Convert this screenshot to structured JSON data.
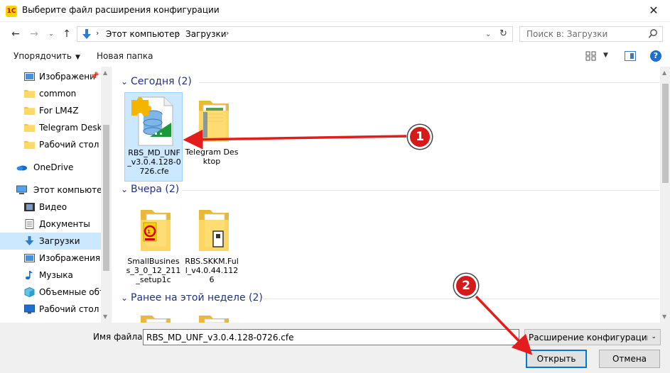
{
  "window": {
    "app_icon": "1С",
    "title": "Выберите файл расширения конфигурации",
    "close": "✕"
  },
  "nav": {
    "back": "←",
    "forward": "→",
    "up": "↑",
    "breadcrumbs": [
      "Этот компьютер",
      "Загрузки"
    ],
    "search_placeholder": "Поиск в: Загрузки"
  },
  "toolbar": {
    "organize_label": "Упорядочить",
    "new_folder_label": "Новая папка",
    "help": "?"
  },
  "sidebar": {
    "items": [
      {
        "label": "Изображени",
        "icon": "pictures-icon"
      },
      {
        "label": "common",
        "icon": "folder-icon"
      },
      {
        "label": "For LM4Z",
        "icon": "folder-icon"
      },
      {
        "label": "Telegram Deskto",
        "icon": "folder-icon"
      },
      {
        "label": "Рабочий стол",
        "icon": "folder-icon"
      },
      {
        "label": "OneDrive",
        "icon": "onedrive-icon"
      },
      {
        "label": "Этот компьютер",
        "icon": "computer-icon"
      },
      {
        "label": "Видео",
        "icon": "video-icon"
      },
      {
        "label": "Документы",
        "icon": "documents-icon"
      },
      {
        "label": "Загрузки",
        "icon": "downloads-icon"
      },
      {
        "label": "Изображения",
        "icon": "pictures-icon"
      },
      {
        "label": "Музыка",
        "icon": "music-icon"
      },
      {
        "label": "Объемные объ",
        "icon": "3d-objects-icon"
      },
      {
        "label": "Рабочий стол",
        "icon": "desktop-icon"
      }
    ]
  },
  "groups": [
    {
      "label": "Сегодня (2)",
      "files": [
        {
          "name": "RBS_MD_UNF_v3.0.4.128-0726.cfe",
          "icon": "cfe-file-icon"
        },
        {
          "name": "Telegram Desktop",
          "icon": "folder-icon"
        }
      ]
    },
    {
      "label": "Вчера (2)",
      "files": [
        {
          "name": "SmallBusiness_3_0_12_211_setup1c",
          "icon": "folder-icon"
        },
        {
          "name": "RBS.SKKM.Full_v4.0.44.1126",
          "icon": "folder-icon"
        }
      ]
    },
    {
      "label": "Ранее на этой неделе (2)",
      "files": []
    }
  ],
  "bottom": {
    "filename_label": "Имя файла:",
    "filename_value": "RBS_MD_UNF_v3.0.4.128-0726.cfe",
    "filetype": "Расширение конфигурации (*",
    "open_label": "Открыть",
    "cancel_label": "Отмена"
  },
  "annotations": {
    "marker1": "1",
    "marker2": "2"
  },
  "colors": {
    "accent": "#0078d7",
    "selection": "#cce8ff",
    "group_header": "#1e3287",
    "marker": "#d61a1a"
  }
}
